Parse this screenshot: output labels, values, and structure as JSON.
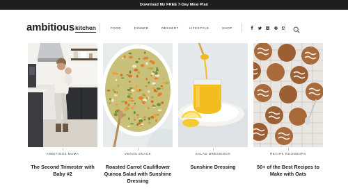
{
  "promo": {
    "text": "Download My FREE 7-Day Meal Plan"
  },
  "logo": {
    "main": "ambitious",
    "sub": "kitchen"
  },
  "nav": [
    "FOOD",
    "DINNER",
    "DESSERT",
    "LIFESTYLE",
    "SHOP"
  ],
  "social_icons": [
    "facebook-icon",
    "twitter-icon",
    "instagram-icon",
    "pinterest-icon",
    "email-icon"
  ],
  "cards": [
    {
      "category": "AMBITIOUS MAMA",
      "title_lines": [
        "The Second Trimester with",
        "Baby #2"
      ]
    },
    {
      "category": "VEGAN SNACK",
      "title_lines": [
        "Roasted Carrot Cauliflower",
        "Quinoa Salad with Sunshine",
        "Dressing"
      ]
    },
    {
      "category": "SALAD DRESSINGS",
      "title_lines": [
        "Sunshine Dressing"
      ]
    },
    {
      "category": "RECIPE ROUNDUPS",
      "title_lines": [
        "50+ of the Best Recipes to",
        "Make with Oats"
      ]
    }
  ],
  "colors": {
    "topbar": "#1c1c1c",
    "text": "#1c1c1c"
  }
}
